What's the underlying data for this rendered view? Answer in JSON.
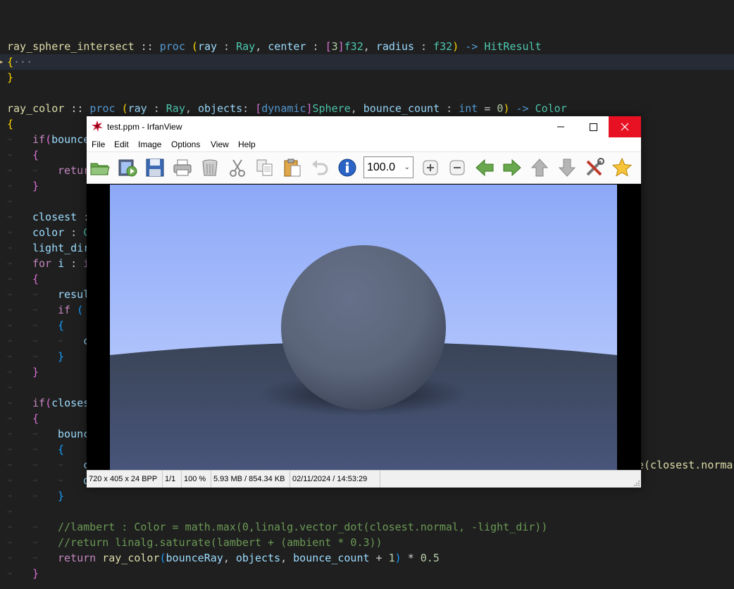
{
  "editor": {
    "lines": [
      {
        "segs": []
      },
      {
        "segs": [
          {
            "t": "ray_sphere_intersect",
            "c": "t-fn"
          },
          {
            "t": " "
          },
          {
            "t": "::",
            "c": "t-op"
          },
          {
            "t": " "
          },
          {
            "t": "proc",
            "c": "t-kw"
          },
          {
            "t": " "
          },
          {
            "t": "(",
            "c": "t-br1"
          },
          {
            "t": "ray",
            "c": "t-var"
          },
          {
            "t": " : "
          },
          {
            "t": "Ray",
            "c": "t-type"
          },
          {
            "t": ", "
          },
          {
            "t": "center",
            "c": "t-var"
          },
          {
            "t": " : "
          },
          {
            "t": "[",
            "c": "t-br2"
          },
          {
            "t": "3",
            "c": "t-num"
          },
          {
            "t": "]",
            "c": "t-br2"
          },
          {
            "t": "f32",
            "c": "t-type"
          },
          {
            "t": ", "
          },
          {
            "t": "radius",
            "c": "t-var"
          },
          {
            "t": " : "
          },
          {
            "t": "f32",
            "c": "t-type"
          },
          {
            "t": ")",
            "c": "t-br1"
          },
          {
            "t": " -> ",
            "c": "t-kw"
          },
          {
            "t": "HitResult",
            "c": "t-type"
          }
        ]
      },
      {
        "segs": [
          {
            "t": "{",
            "c": "t-br1"
          },
          {
            "t": "···",
            "c": "ellipsis"
          }
        ],
        "current": true,
        "fold": true
      },
      {
        "segs": [
          {
            "t": "}",
            "c": "t-br1"
          }
        ]
      },
      {
        "segs": []
      },
      {
        "segs": [
          {
            "t": "ray_color",
            "c": "t-fn"
          },
          {
            "t": " "
          },
          {
            "t": "::",
            "c": "t-op"
          },
          {
            "t": " "
          },
          {
            "t": "proc",
            "c": "t-kw"
          },
          {
            "t": " "
          },
          {
            "t": "(",
            "c": "t-br1"
          },
          {
            "t": "ray",
            "c": "t-var"
          },
          {
            "t": " : "
          },
          {
            "t": "Ray",
            "c": "t-type"
          },
          {
            "t": ", "
          },
          {
            "t": "objects",
            "c": "t-var"
          },
          {
            "t": ": "
          },
          {
            "t": "[",
            "c": "t-br2"
          },
          {
            "t": "dynamic",
            "c": "t-kw"
          },
          {
            "t": "]",
            "c": "t-br2"
          },
          {
            "t": "Sphere",
            "c": "t-type"
          },
          {
            "t": ", "
          },
          {
            "t": "bounce_count",
            "c": "t-var"
          },
          {
            "t": " : "
          },
          {
            "t": "int",
            "c": "t-kw"
          },
          {
            "t": " = "
          },
          {
            "t": "0",
            "c": "t-num"
          },
          {
            "t": ")",
            "c": "t-br1"
          },
          {
            "t": " -> ",
            "c": "t-kw"
          },
          {
            "t": "Color",
            "c": "t-type"
          }
        ]
      },
      {
        "segs": [
          {
            "t": "{",
            "c": "t-br1"
          }
        ]
      },
      {
        "g": 1,
        "segs": [
          {
            "t": "if",
            "c": "t-ctl"
          },
          {
            "t": "(",
            "c": "t-br2"
          },
          {
            "t": "bounce",
            "c": "t-var"
          }
        ]
      },
      {
        "g": 1,
        "segs": [
          {
            "t": "{",
            "c": "t-br2"
          }
        ]
      },
      {
        "g": 2,
        "segs": [
          {
            "t": "retur",
            "c": "t-ctl"
          }
        ]
      },
      {
        "g": 1,
        "segs": [
          {
            "t": "}",
            "c": "t-br2"
          }
        ]
      },
      {
        "g": 1,
        "segs": []
      },
      {
        "g": 1,
        "segs": [
          {
            "t": "closest",
            "c": "t-var"
          },
          {
            "t": " :"
          }
        ]
      },
      {
        "g": 1,
        "segs": [
          {
            "t": "color",
            "c": "t-var"
          },
          {
            "t": " : "
          },
          {
            "t": "C",
            "c": "t-type"
          }
        ]
      },
      {
        "g": 1,
        "segs": [
          {
            "t": "light_dir",
            "c": "t-var"
          }
        ]
      },
      {
        "g": 1,
        "segs": [
          {
            "t": "for",
            "c": "t-ctl"
          },
          {
            "t": " "
          },
          {
            "t": "i",
            "c": "t-var"
          },
          {
            "t": " : "
          },
          {
            "t": "i",
            "c": "t-ctl"
          }
        ]
      },
      {
        "g": 1,
        "segs": [
          {
            "t": "{",
            "c": "t-br2"
          }
        ]
      },
      {
        "g": 2,
        "segs": [
          {
            "t": "resul",
            "c": "t-var"
          }
        ]
      },
      {
        "g": 2,
        "segs": [
          {
            "t": "if",
            "c": "t-ctl"
          },
          {
            "t": " "
          },
          {
            "t": "(",
            "c": "t-br3"
          }
        ]
      },
      {
        "g": 2,
        "segs": [
          {
            "t": "{",
            "c": "t-br3"
          }
        ]
      },
      {
        "g": 3,
        "segs": [
          {
            "t": "c",
            "c": "t-var"
          }
        ]
      },
      {
        "g": 2,
        "segs": [
          {
            "t": "}",
            "c": "t-br3"
          }
        ]
      },
      {
        "g": 1,
        "segs": [
          {
            "t": "}",
            "c": "t-br2"
          }
        ]
      },
      {
        "g": 1,
        "segs": []
      },
      {
        "g": 1,
        "segs": [
          {
            "t": "if",
            "c": "t-ctl"
          },
          {
            "t": "(",
            "c": "t-br2"
          },
          {
            "t": "closes",
            "c": "t-var"
          }
        ]
      },
      {
        "g": 1,
        "segs": [
          {
            "t": "{",
            "c": "t-br2"
          }
        ]
      },
      {
        "g": 2,
        "segs": [
          {
            "t": "bounc",
            "c": "t-var"
          }
        ]
      },
      {
        "g": 2,
        "segs": [
          {
            "t": "{",
            "c": "t-br3"
          }
        ]
      },
      {
        "g": 3,
        "segs": [
          {
            "t": "c",
            "c": "t-var"
          }
        ]
      },
      {
        "g": 3,
        "segs": [
          {
            "t": "d",
            "c": "t-var"
          }
        ]
      },
      {
        "g": 2,
        "segs": [
          {
            "t": "}",
            "c": "t-br3"
          }
        ]
      },
      {
        "g": 1,
        "segs": []
      },
      {
        "g": 2,
        "segs": [
          {
            "t": "//lambert : Color = math.max(0,linalg.vector_dot(closest.normal, -light_dir))",
            "c": "t-com"
          }
        ]
      },
      {
        "g": 2,
        "segs": [
          {
            "t": "//return linalg.saturate(lambert + (ambient * 0.3))",
            "c": "t-com"
          }
        ]
      },
      {
        "g": 2,
        "segs": [
          {
            "t": "return",
            "c": "t-ctl"
          },
          {
            "t": " "
          },
          {
            "t": "ray_color",
            "c": "t-fn"
          },
          {
            "t": "(",
            "c": "t-br3"
          },
          {
            "t": "bounceRay",
            "c": "t-var"
          },
          {
            "t": ", "
          },
          {
            "t": "objects",
            "c": "t-var"
          },
          {
            "t": ", "
          },
          {
            "t": "bounce_count",
            "c": "t-var"
          },
          {
            "t": " + "
          },
          {
            "t": "1",
            "c": "t-num"
          },
          {
            "t": ")",
            "c": "t-br3"
          },
          {
            "t": " * "
          },
          {
            "t": "0.5",
            "c": "t-num"
          }
        ]
      },
      {
        "g": 1,
        "segs": [
          {
            "t": "}",
            "c": "t-br2"
          }
        ]
      }
    ],
    "right_fragment": "e(closest.norma"
  },
  "viewer": {
    "title": "test.ppm - IrfanView",
    "menu": [
      "File",
      "Edit",
      "Image",
      "Options",
      "View",
      "Help"
    ],
    "toolbar_icons": [
      "open-folder-icon",
      "slideshow-icon",
      "save-icon",
      "print-icon",
      "delete-icon",
      "cut-icon",
      "copy-icon",
      "paste-icon",
      "undo-icon",
      "info-icon",
      "zoom-in-icon",
      "zoom-out-icon",
      "previous-icon",
      "next-icon",
      "first-icon",
      "last-icon",
      "settings-icon",
      "favorite-icon"
    ],
    "zoom": "100.0",
    "status": [
      "720 x 405 x 24 BPP",
      "1/1",
      "100 %",
      "5.93 MB / 854.34 KB",
      "02/11/2024 / 14:53:29"
    ],
    "colors": {
      "sky_top": "#8da9f7",
      "sky_bottom": "#c5d3ff",
      "ground_top": "#3a4457",
      "ground_bottom": "#48557a",
      "sphere": "#5b6579"
    }
  }
}
